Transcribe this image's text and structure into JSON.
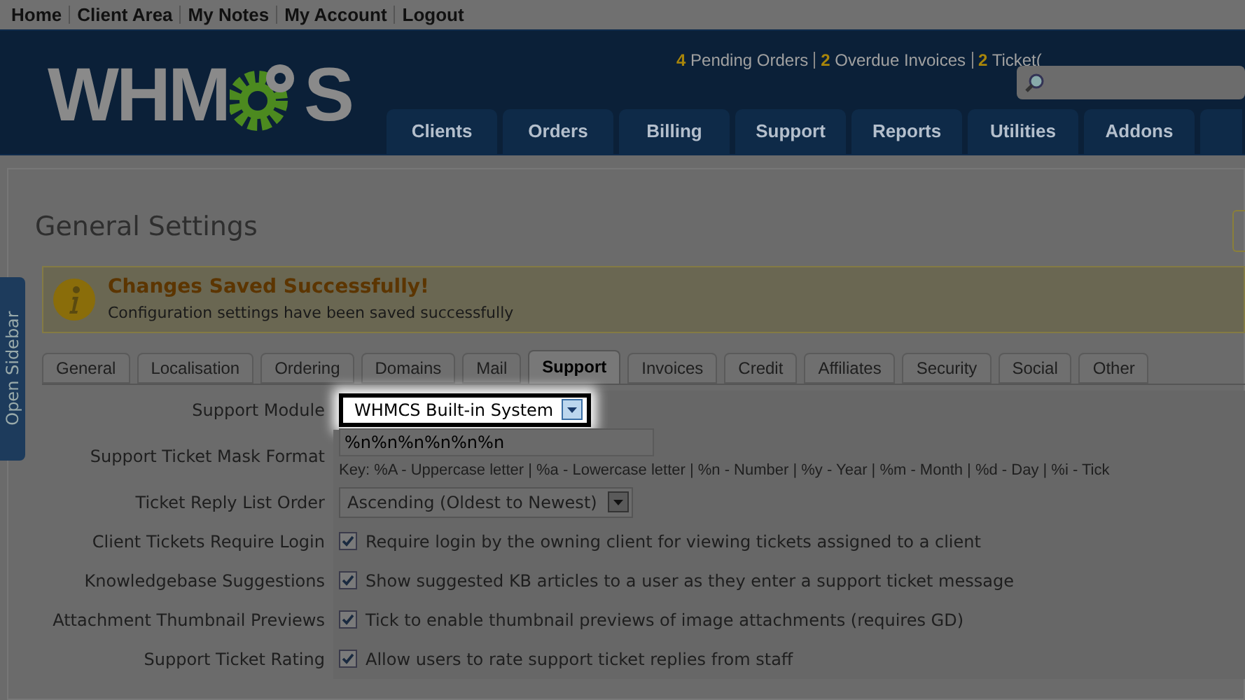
{
  "top_links": [
    "Home",
    "Client Area",
    "My Notes",
    "My Account",
    "Logout"
  ],
  "header": {
    "logo_left": "WHM",
    "logo_right": "S",
    "stats": [
      {
        "count": "4",
        "label": "Pending Orders"
      },
      {
        "count": "2",
        "label": "Overdue Invoices"
      },
      {
        "count": "2",
        "label": "Ticket("
      }
    ],
    "nav": [
      "Clients",
      "Orders",
      "Billing",
      "Support",
      "Reports",
      "Utilities",
      "Addons"
    ]
  },
  "page_title": "General Settings",
  "alert": {
    "title": "Changes Saved Successfully!",
    "message": "Configuration settings have been saved successfully"
  },
  "sidebar_tab": "Open Sidebar",
  "tabs": [
    {
      "label": "General",
      "selected": false
    },
    {
      "label": "Localisation",
      "selected": false
    },
    {
      "label": "Ordering",
      "selected": false
    },
    {
      "label": "Domains",
      "selected": false
    },
    {
      "label": "Mail",
      "selected": false
    },
    {
      "label": "Support",
      "selected": true
    },
    {
      "label": "Invoices",
      "selected": false
    },
    {
      "label": "Credit",
      "selected": false
    },
    {
      "label": "Affiliates",
      "selected": false
    },
    {
      "label": "Security",
      "selected": false
    },
    {
      "label": "Social",
      "selected": false
    },
    {
      "label": "Other",
      "selected": false
    }
  ],
  "settings": [
    {
      "kind": "select",
      "label": "Support Module",
      "value": "WHMCS Built-in System",
      "highlighted": true
    },
    {
      "kind": "text",
      "label": "Support Ticket Mask Format",
      "value": "%n%n%n%n%n%n",
      "hint": "Key: %A - Uppercase letter | %a - Lowercase letter | %n - Number | %y - Year | %m - Month | %d - Day | %i - Tick"
    },
    {
      "kind": "select",
      "label": "Ticket Reply List Order",
      "value": "Ascending (Oldest to Newest)",
      "highlighted": false
    },
    {
      "kind": "checkbox",
      "label": "Client Tickets Require Login",
      "checked": true,
      "text": "Require login by the owning client for viewing tickets assigned to a client"
    },
    {
      "kind": "checkbox",
      "label": "Knowledgebase Suggestions",
      "checked": true,
      "text": "Show suggested KB articles to a user as they enter a support ticket message"
    },
    {
      "kind": "checkbox",
      "label": "Attachment Thumbnail Previews",
      "checked": true,
      "text": "Tick to enable thumbnail previews of image attachments (requires GD)"
    },
    {
      "kind": "checkbox",
      "label": "Support Ticket Rating",
      "checked": true,
      "text": "Allow users to rate support ticket replies from staff"
    }
  ]
}
